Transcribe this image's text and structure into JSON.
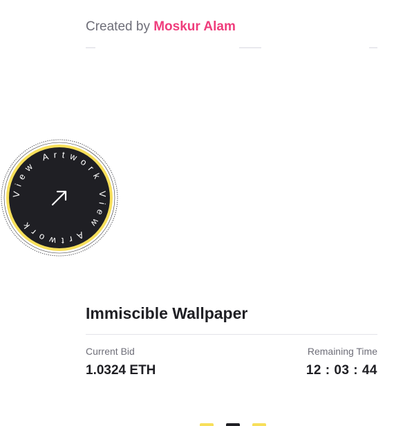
{
  "header": {
    "created_by_prefix": "Created by",
    "author_name": "Moskur Alam"
  },
  "badge": {
    "ring_text": "View Artwork View Artwork",
    "icon": "arrow-up-right-icon",
    "ring_color": "#f7df5a",
    "fill_color": "#1f1f24"
  },
  "artwork": {
    "title": "Immiscible Wallpaper"
  },
  "auction": {
    "current_bid_label": "Current Bid",
    "current_bid_value": "1.0324 ETH",
    "remaining_time_label": "Remaining Time",
    "remaining_time_value": "12 : 03 : 44"
  },
  "pager": {
    "dots": [
      {
        "color": "#f7df5a",
        "active": false
      },
      {
        "color": "#1f1f24",
        "active": true
      },
      {
        "color": "#f7df5a",
        "active": false
      }
    ]
  },
  "colors": {
    "accent": "#ef3d7c",
    "text": "#1f1f24",
    "muted": "#6e6e78"
  }
}
